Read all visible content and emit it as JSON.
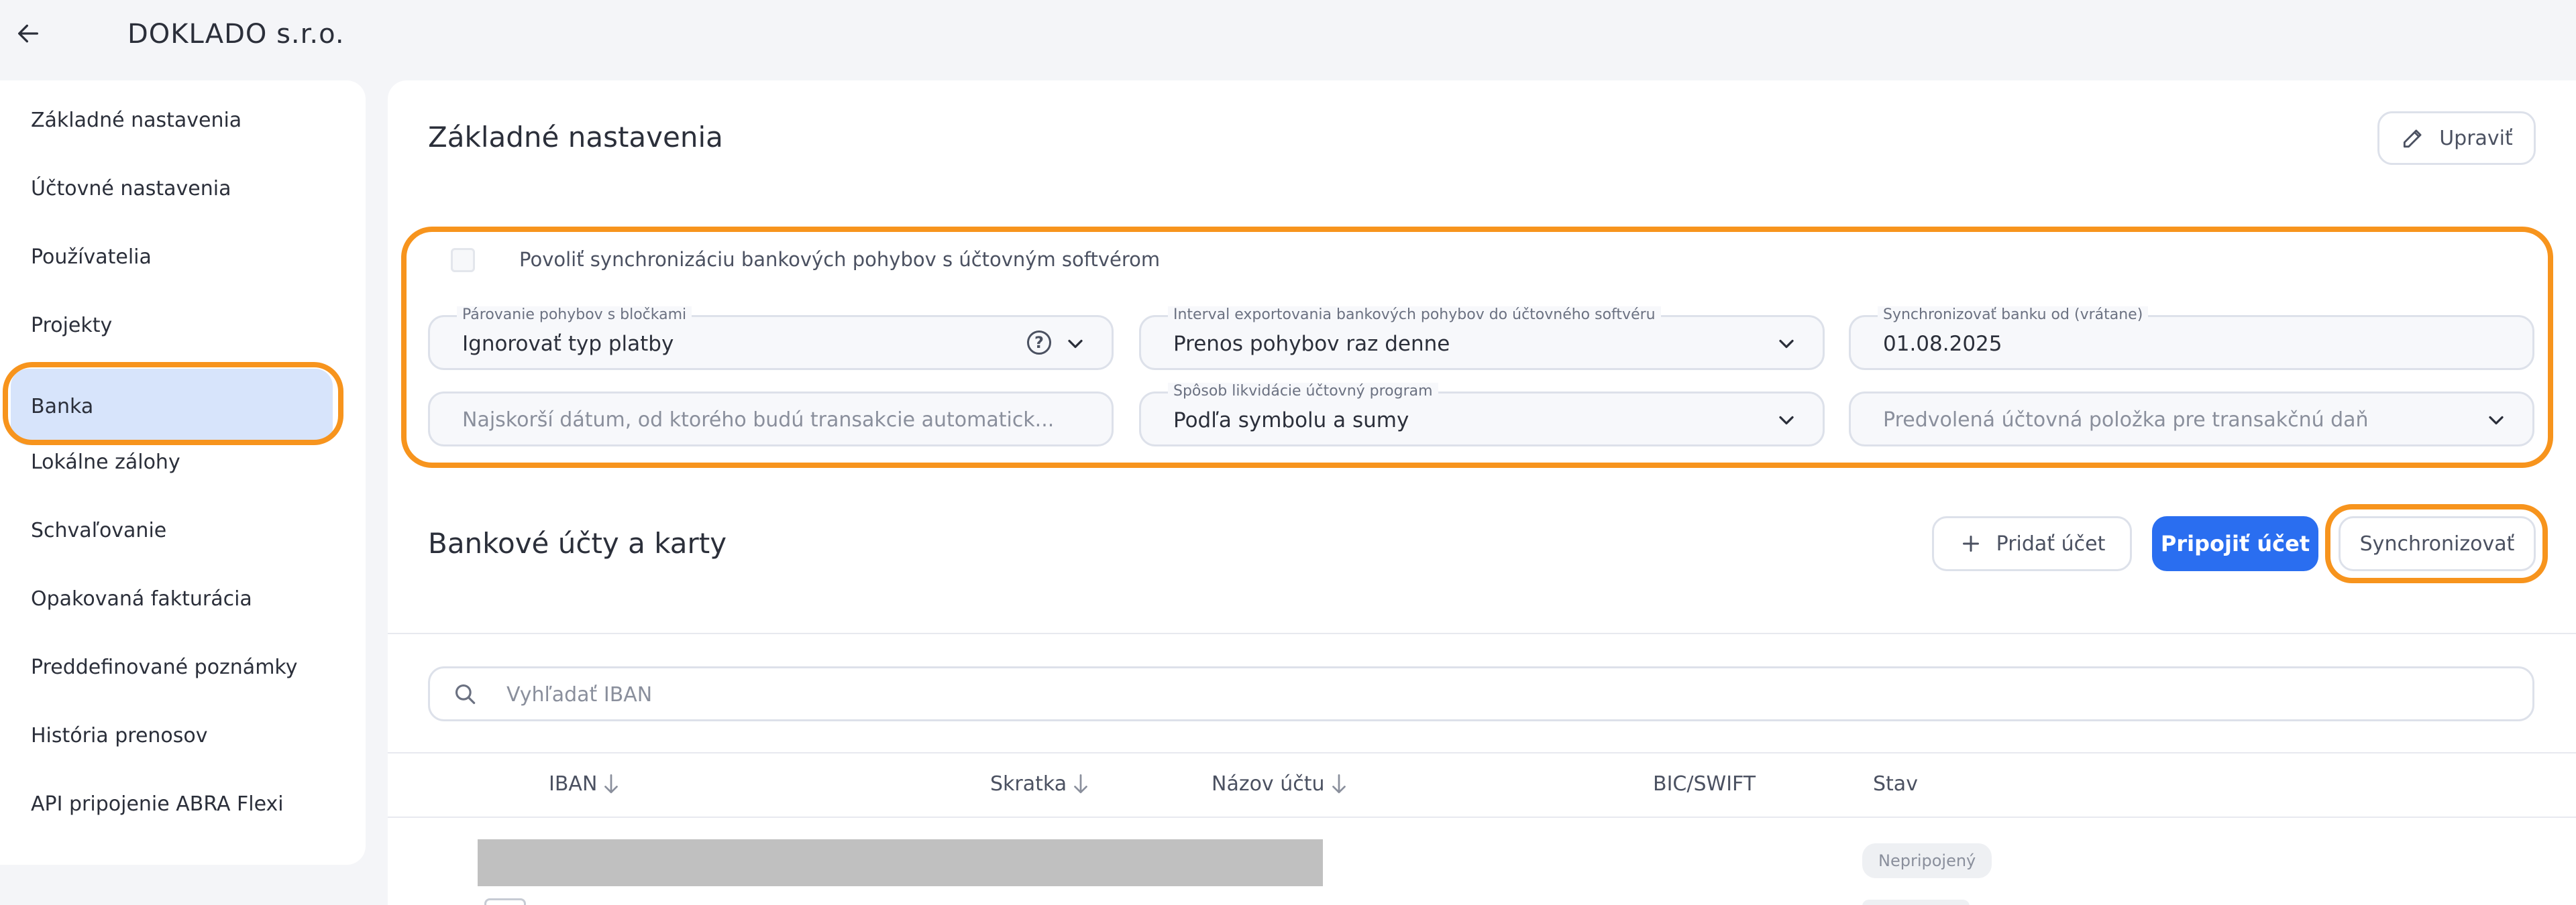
{
  "header": {
    "company": "DOKLADO s.r.o."
  },
  "sidebar": {
    "items": [
      {
        "label": "Základné nastavenia"
      },
      {
        "label": "Účtovné nastavenia"
      },
      {
        "label": "Používatelia"
      },
      {
        "label": "Projekty"
      },
      {
        "label": "Banka",
        "active": true
      },
      {
        "label": "Lokálne zálohy"
      },
      {
        "label": "Schvaľovanie"
      },
      {
        "label": "Opakovaná fakturácia"
      },
      {
        "label": "Preddefinované poznámky"
      },
      {
        "label": "História prenosov"
      },
      {
        "label": "API pripojenie ABRA Flexi"
      }
    ]
  },
  "basic": {
    "title": "Základné nastavenia",
    "edit_label": "Upraviť",
    "sync_checkbox_label": "Povoliť synchronizáciu bankových pohybov s účtovným softvérom",
    "sync_checked": false,
    "fields": {
      "pairing": {
        "label": "Párovanie pohybov s bločkami",
        "value": "Ignorovať typ platby"
      },
      "interval": {
        "label": "Interval exportovania bankových pohybov do účtovného softvéru",
        "value": "Prenos pohybov raz denne"
      },
      "sync_from": {
        "label": "Synchronizovať banku od (vrátane)",
        "value": "01.08.2025"
      },
      "earliest_date": {
        "placeholder": "Najskorší dátum, od ktorého budú transakcie automatick..."
      },
      "liquidation": {
        "label": "Spôsob likvidácie účtovný program",
        "value": "Podľa symbolu a sumy"
      },
      "default_item": {
        "placeholder": "Predvolená účtovná položka pre transakčnú daň"
      }
    }
  },
  "accounts": {
    "title": "Bankové účty a karty",
    "add_label": "Pridať účet",
    "connect_label": "Pripojiť účet",
    "sync_label": "Synchronizovať",
    "search_placeholder": "Vyhľadať IBAN",
    "columns": [
      "IBAN",
      "Skratka",
      "Názov účtu",
      "BIC/SWIFT",
      "Stav"
    ],
    "rows": [
      {
        "status": "Nepripojený"
      }
    ]
  },
  "colors": {
    "accent": "#2a6ef0",
    "highlight": "#f7941d",
    "active_bg": "#d7e4fb"
  },
  "icons": [
    "back-arrow-icon",
    "pencil-icon",
    "help-icon",
    "chevron-down-icon",
    "plus-icon",
    "search-icon",
    "sort-arrow-icon"
  ]
}
